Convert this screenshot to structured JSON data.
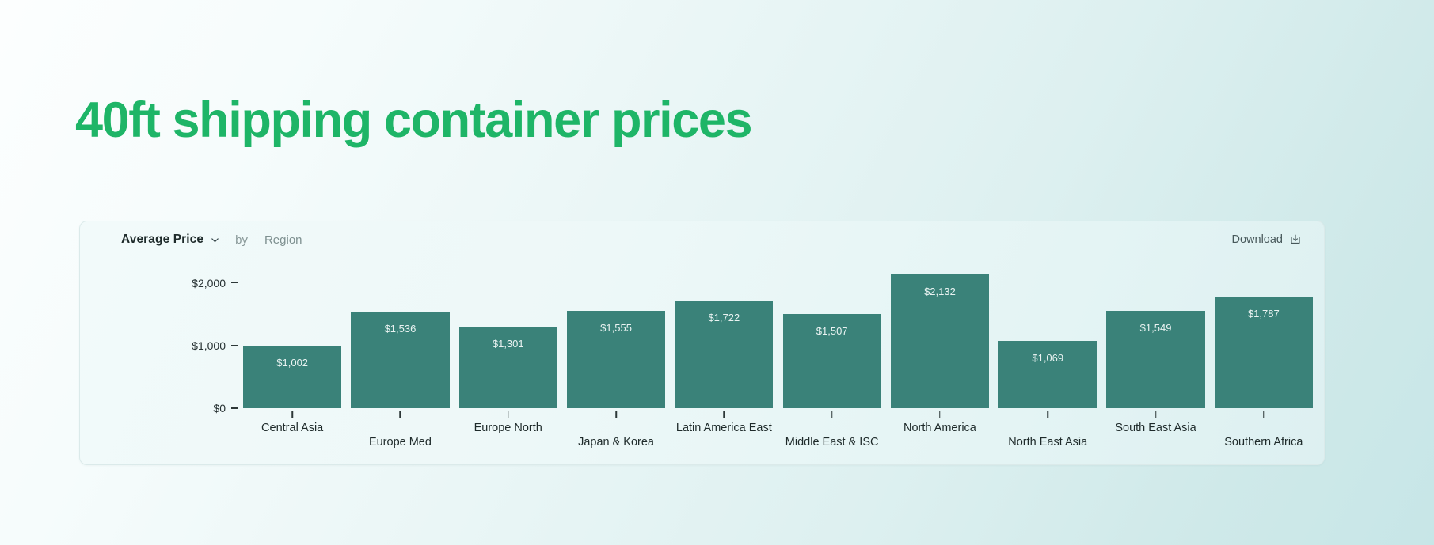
{
  "page": {
    "title": "40ft shipping container prices",
    "accent_color": "#1eb567",
    "background_from": "#fcfefe",
    "background_to": "#c7e6e7"
  },
  "card": {
    "header": {
      "metric": "Average Price",
      "metric_caret_icon": "chevron-down-icon",
      "by_word": "by",
      "dimension": "Region",
      "download_label": "Download",
      "download_icon": "download-tray-icon"
    }
  },
  "chart_data": {
    "type": "bar",
    "title": "40ft shipping container prices",
    "xlabel": "Region",
    "ylabel": "Average Price",
    "ylim": [
      0,
      2400
    ],
    "grid": false,
    "legend": "none",
    "bar_color": "#3a8279",
    "value_label_color": "#eaf3f2",
    "y_ticks": [
      0,
      1000,
      2000
    ],
    "y_tick_labels": [
      "$0",
      "$1,000",
      "$2,000"
    ],
    "categories": [
      "Central Asia",
      "Europe Med",
      "Europe North",
      "Japan & Korea",
      "Latin America East",
      "Middle East & ISC",
      "North America",
      "North East Asia",
      "South East Asia",
      "Southern Africa"
    ],
    "values": [
      1002,
      1536,
      1301,
      1555,
      1722,
      1507,
      2132,
      1069,
      1549,
      1787
    ],
    "value_labels": [
      "$1,002",
      "$1,536",
      "$1,301",
      "$1,555",
      "$1,722",
      "$1,507",
      "$2,132",
      "$1,069",
      "$1,549",
      "$1,787"
    ]
  }
}
